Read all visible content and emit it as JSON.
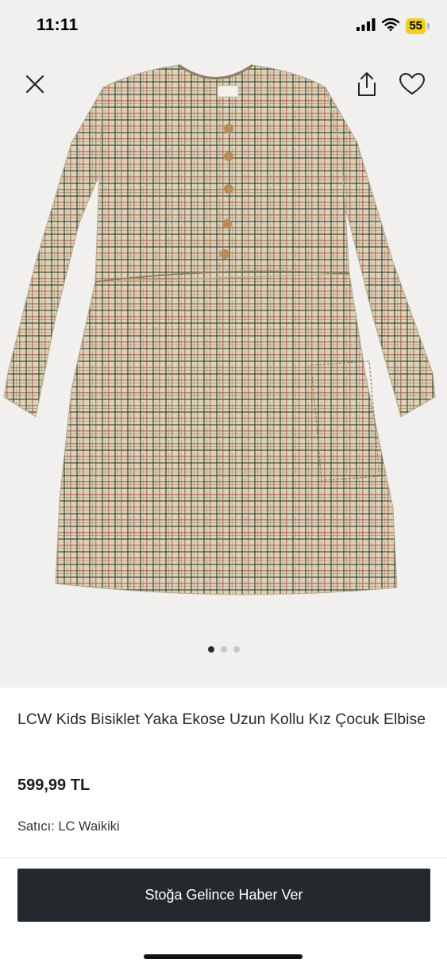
{
  "status_bar": {
    "time": "11:11",
    "battery": "55",
    "icons": [
      "signal-icon",
      "wifi-icon",
      "battery-icon"
    ]
  },
  "gallery": {
    "page_count": 3,
    "active_page": 1,
    "icons": {
      "close": "close-icon",
      "share": "share-icon",
      "favorite": "heart-icon"
    },
    "product_image": "plaid-long-sleeve-dress"
  },
  "product": {
    "title": "LCW Kids Bisiklet Yaka Ekose Uzun Kollu Kız Çocuk Elbise",
    "price": "599,99 TL",
    "seller_label": "Satıcı:",
    "seller_name": "LC Waikiki"
  },
  "actions": {
    "notify_button": "Stoğa Gelince Haber Ver"
  },
  "colors": {
    "button_bg": "#24292d",
    "gallery_bg": "#f1f0ee",
    "battery": "#f2cf1d"
  }
}
